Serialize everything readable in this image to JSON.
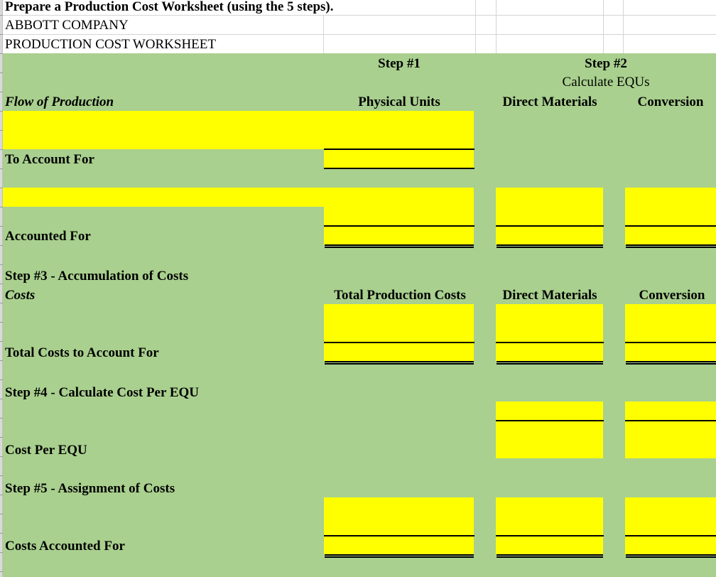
{
  "sheet": {
    "title": "Prepare a Production Cost Worksheet (using the 5 steps).",
    "company": "ABBOTT COMPANY",
    "worksheet_name": "PRODUCTION COST WORKSHEET"
  },
  "headers": {
    "step1": "Step #1",
    "step2": "Step #2",
    "step2_sub": "Calculate EQUs",
    "flow_of_production": "Flow of Production",
    "physical_units": "Physical Units",
    "direct_materials": "Direct Materials",
    "conversion": "Conversion"
  },
  "rows": {
    "to_account_for": "To Account For",
    "accounted_for": "Accounted For",
    "step3": "Step #3 - Accumulation of Costs",
    "costs": "Costs",
    "total_production_costs": "Total Production Costs",
    "direct_materials": "Direct Materials",
    "conversion": "Conversion",
    "total_costs_to_account_for": "Total Costs to Account For",
    "step4": "Step #4 - Calculate Cost Per EQU",
    "cost_per_equ": "Cost Per EQU",
    "step5": "Step #5 - Assignment of Costs",
    "costs_accounted_for": "Costs Accounted For"
  },
  "colors": {
    "worksheet_fill": "#a9d08e",
    "input_fill": "#ffff00",
    "gridline": "#d4d4d4"
  }
}
